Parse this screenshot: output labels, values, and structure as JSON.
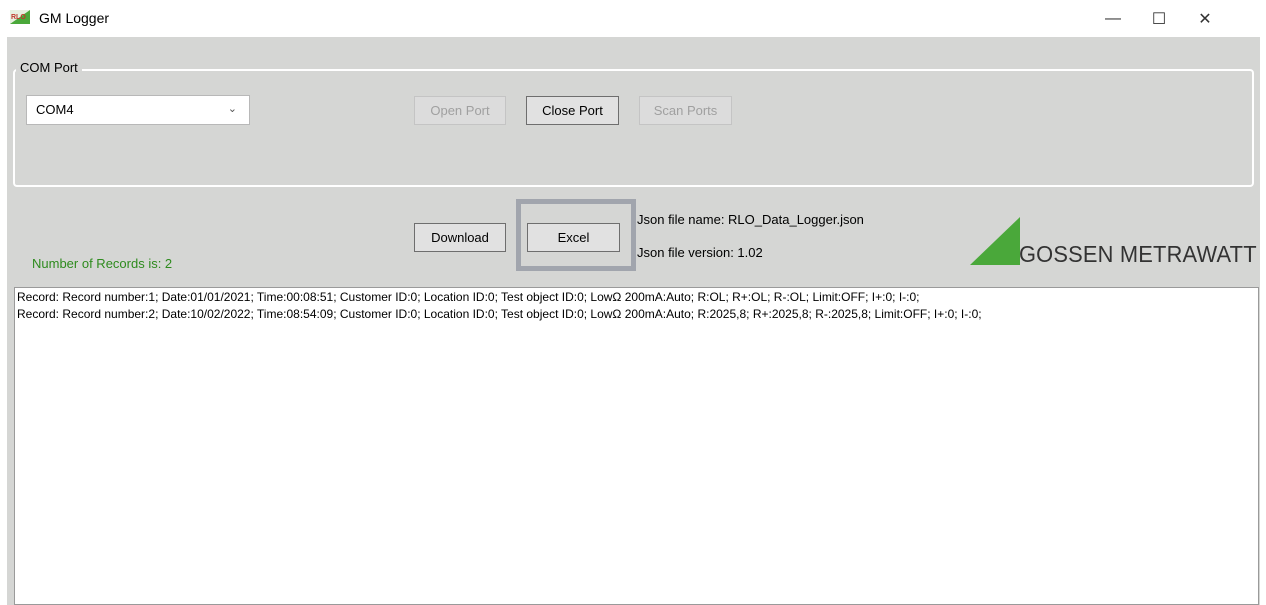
{
  "window": {
    "icon_text": "RLO",
    "title": "GM Logger",
    "minimize": "—",
    "maximize": "☐",
    "close": "✕"
  },
  "com_group": {
    "legend": "COM Port",
    "selected_port": "COM4",
    "open_label": "Open Port",
    "close_label": "Close Port",
    "scan_label": "Scan Ports"
  },
  "actions": {
    "download_label": "Download",
    "excel_label": "Excel"
  },
  "status": {
    "records_count": "Number of Records is: 2",
    "json_name": "Json file name: RLO_Data_Logger.json",
    "json_version": "Json file version: 1.02"
  },
  "logo": {
    "text": "GOSSEN METRAWATT",
    "color": "#4aa83a"
  },
  "records": [
    "Record: Record number:1;  Date:01/01/2021;  Time:00:08:51;  Customer ID:0;  Location ID:0;  Test object ID:0;  LowΩ 200mA:Auto; R:OL;  R+:OL;  R-:OL;  Limit:OFF;  I+:0;  I-:0;",
    "Record: Record number:2;  Date:10/02/2022;  Time:08:54:09;  Customer ID:0;  Location ID:0;  Test object ID:0;  LowΩ 200mA:Auto; R:2025,8;  R+:2025,8;  R-:2025,8;  Limit:OFF;  I+:0;  I-:0;"
  ]
}
